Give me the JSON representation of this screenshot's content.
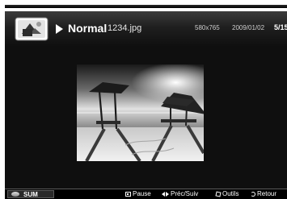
{
  "header": {
    "mode": "Normal",
    "filename": "1234.jpg",
    "resolution": "580x765",
    "date": "2009/01/02",
    "page": "5/15",
    "icon": "photo-folder-icon"
  },
  "viewer": {
    "image_icon": "beach-photo"
  },
  "footer": {
    "sum_label": "SUM",
    "pause_label": "Pause",
    "prevnext_label": "Préc/Suiv",
    "tools_label": "Outils",
    "return_label": "Retour",
    "icons": {
      "sum": "sum-icon",
      "pause": "pause-icon",
      "prevnext": "prev-next-icon",
      "tools": "tools-icon",
      "return": "return-icon"
    }
  }
}
